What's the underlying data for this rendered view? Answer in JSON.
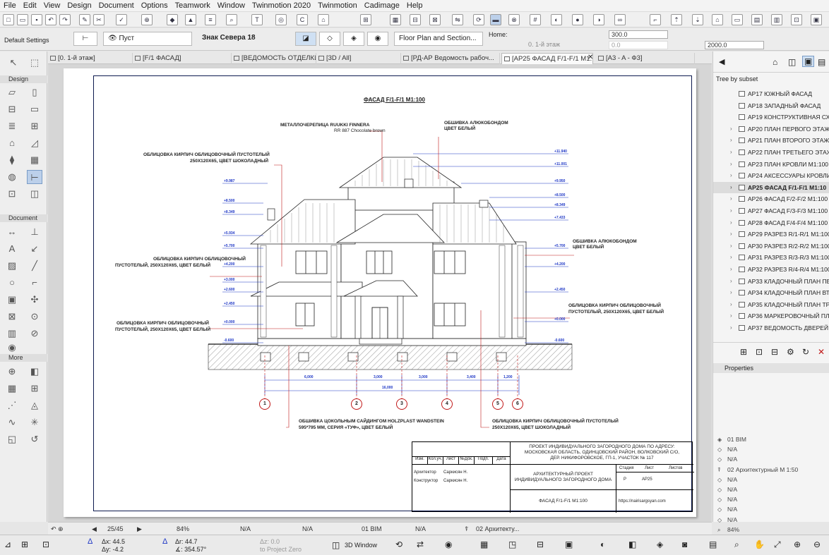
{
  "menu": [
    "File",
    "Edit",
    "View",
    "Design",
    "Document",
    "Options",
    "Teamwork",
    "Window",
    "Twinmotion 2020",
    "Twinmotion",
    "Cadimage",
    "Help"
  ],
  "info_box": {
    "default_settings": "Default Settings",
    "layer": "Пуст",
    "marker_name": "Знак Севера 18",
    "view_type": "Floor Plan and Section...",
    "home_label": "Home:",
    "home_story": "0. 1-й этаж",
    "height_value": "300.0",
    "offset_value": "0.0",
    "size_value": "2000.0"
  },
  "tabs": [
    "[0. 1-й этаж]",
    "[F/1 ФАСАД]",
    "[ВЕДОМОСТЬ ОТДЕЛКИ ...",
    "[3D / All]",
    "[РД-АР Ведомость рабоч...",
    "[AP25 ФАСАД  F/1-F/1  M1...",
    "[A3 - A - Ф3]"
  ],
  "toolbox": {
    "design": "Design",
    "document": "Document",
    "more": "More"
  },
  "navigator": {
    "header": "Tree by subset",
    "items": [
      "AP17 ЮЖНЫЙ ФАСАД",
      "AP18 ЗАПАДНЫЙ ФАСАД",
      "AP19 КОНСТРУКТИВНАЯ СХЕ",
      "AP20 ПЛАН ПЕРВОГО ЭТАЖА",
      "AP21 ПЛАН ВТОРОГО ЭТАЖА",
      "AP22 ПЛАН ТРЕТЬЕГО ЭТАЖ",
      "AP23 ПЛАН КРОВЛИ M1:100",
      "AP24 АКСЕССУАРЫ КРОВЛИ,",
      "AP25 ФАСАД  F/1-F/1  M1:10",
      "AP26 ФАСАД  F/2-F/2  M1:100",
      "AP27 ФАСАД  F/3-F/3  M1:100",
      "AP28 ФАСАД  F/4-F/4  M1:100",
      "AP29 РАЗРЕЗ R/1-R/1  M1:100",
      "AP30 РАЗРЕЗ R/2-R/2  M1:100",
      "AP31 РАЗРЕЗ R/3-R/3  M1:100",
      "AP32 РАЗРЕЗ R/4-R/4  M1:100",
      "AP33 КЛАДОЧНЫЙ ПЛАН ПЕ",
      "AP34 КЛАДОЧНЫЙ ПЛАН ВТ",
      "AP35 КЛАДОЧНЫЙ ПЛАН ТРЕ",
      "AP36 МАРКЕРОВОЧНЫЙ ПЛА",
      "AP37 ВЕДОМОСТЬ ДВЕРЕЙ И"
    ],
    "active_index": 8
  },
  "properties": {
    "header": "Properties",
    "items": [
      "01 BIM",
      "N/A",
      "N/A",
      "02 Архитектурный М 1:50",
      "N/A",
      "N/A",
      "N/A",
      "N/A",
      "N/A",
      "84%",
      "N/A"
    ]
  },
  "drawing": {
    "title": "ФАСАД  F/1-F/1  M1:100",
    "notes": {
      "roof": "МЕТАЛЛОЧЕРЕПИЦА RUUKKI FINNERA",
      "roof_color": "RR 887 Chocolate brown",
      "alu_top": "ОБШИВКА АЛЮКОБОНДОМ",
      "alu_top_color": "ЦВЕТ БЕЛЫЙ",
      "brick_top_l1": "ОБЛИЦОВКА КИРПИЧ ОБЛИЦОВОЧНЫЙ ПУСТОТЕЛЫЙ",
      "brick_top_l2": "250Х120Х65, ЦВЕТ ШОКОЛАДНЫЙ",
      "alu_right": "ОБШИВКА АЛЮКОБОНДОМ",
      "alu_right_color": "ЦВЕТ БЕЛЫЙ",
      "brick_mid_l1": "ОБЛИЦОВКА КИРПИЧ ОБЛИЦОВОЧНЫЙ",
      "brick_mid_l2": "ПУСТОТЕЛЫЙ, 250Х120Х65, ЦВЕТ БЕЛЫЙ",
      "brick_low_l1": "ОБЛИЦОВКА КИРПИЧ ОБЛИЦОВОЧНЫЙ",
      "brick_low_l2": "ПУСТОТЕЛЫЙ, 250Х120Х65, ЦВЕТ БЕЛЫЙ",
      "brick_right_l1": "ОБЛИЦОВКА КИРПИЧ ОБЛИЦОВОЧНЫЙ",
      "brick_right_l2": "ПУСТОТЕЛЫЙ, 250Х120Х65, ЦВЕТ БЕЛЫЙ",
      "plinth_l1": "ОБШИВКА ЦОКОЛЬНЫМ САЙДИНГОМ HOLZPLAST WANDSTEIN",
      "plinth_l2": "595*795 ММ, СЕРИЯ «ТУФ», ЦВЕТ БЕЛЫЙ",
      "brick_br_l1": "ОБЛИЦОВКА КИРПИЧ ОБЛИЦОВОЧНЫЙ ПУСТОТЕЛЫЙ",
      "brick_br_l2": "250Х120Х65, ЦВЕТ ШОКОЛАДНЫЙ"
    },
    "levels_left": [
      "+9.987",
      "+8.500",
      "+8.349",
      "+5.934",
      "+5.700",
      "+4.200",
      "+3.000",
      "+2.600",
      "+2.450",
      "+0.000",
      "-0.600"
    ],
    "levels_right": [
      "+11.940",
      "+11.001",
      "+9.950",
      "+8.500",
      "+8.349",
      "+7.433",
      "+5.700",
      "+4.200",
      "+2.450",
      "+0.000",
      "-0.600"
    ],
    "dims": [
      "6,000",
      "3,000",
      "3,000",
      "3,400",
      "1,200",
      "16,000"
    ],
    "axes": [
      "1",
      "2",
      "3",
      "4",
      "5",
      "6"
    ],
    "stamp": {
      "project_l1": "ПРОЕКТ ИНДИВИДУАЛЬНОГО ЗАГОРОДНОГО ДОМА ПО АДРЕСУ:",
      "project_l2": "МОСКОВСКАЯ ОБЛАСТЬ, ОДИНЦОВСКИЙ РАЙОН, ВОЛКОВСКИЙ С/О,",
      "project_l3": "ДЕР. НИКИФОРОВСКОЕ, ГП-1, УЧАСТОК № 117",
      "cols": [
        "Изм.",
        "Кол.уч.",
        "Лист",
        "№Док.",
        "Подп.",
        "Дата"
      ],
      "role1": "Архитектор",
      "name1": "Саркисян Н.",
      "role2": "Конструктор",
      "name2": "Саркисян Н.",
      "arch_l1": "АРХИТЕКТУРНЫЙ ПРОЕКТ",
      "arch_l2": "ИНДИВИДУАЛЬНОГО ЗАГОРОДНОГО ДОМА",
      "stage": "Стадия",
      "sheet": "Лист",
      "sheets": "Листов",
      "stage_val": "Р",
      "sheet_val": "AP25",
      "sheet_title": "ФАСАД  F/1-F/1  M1:100",
      "site": "https://nairisargsyan.com"
    }
  },
  "status": {
    "page": "25/45",
    "zoom": "84%",
    "na1": "N/A",
    "na2": "N/A",
    "layer_combo": "01 BIM",
    "na3": "N/A",
    "pen_set": "02 Архитекту..."
  },
  "bottom": {
    "dx": "Δx: 44.5",
    "dy": "Δy: -4.2",
    "ax": "Δr: 44.7",
    "ang": "∡: 354.57°",
    "az": "Δz: 0.0",
    "zero": "to Project Zero",
    "view3d": "3D Window"
  }
}
